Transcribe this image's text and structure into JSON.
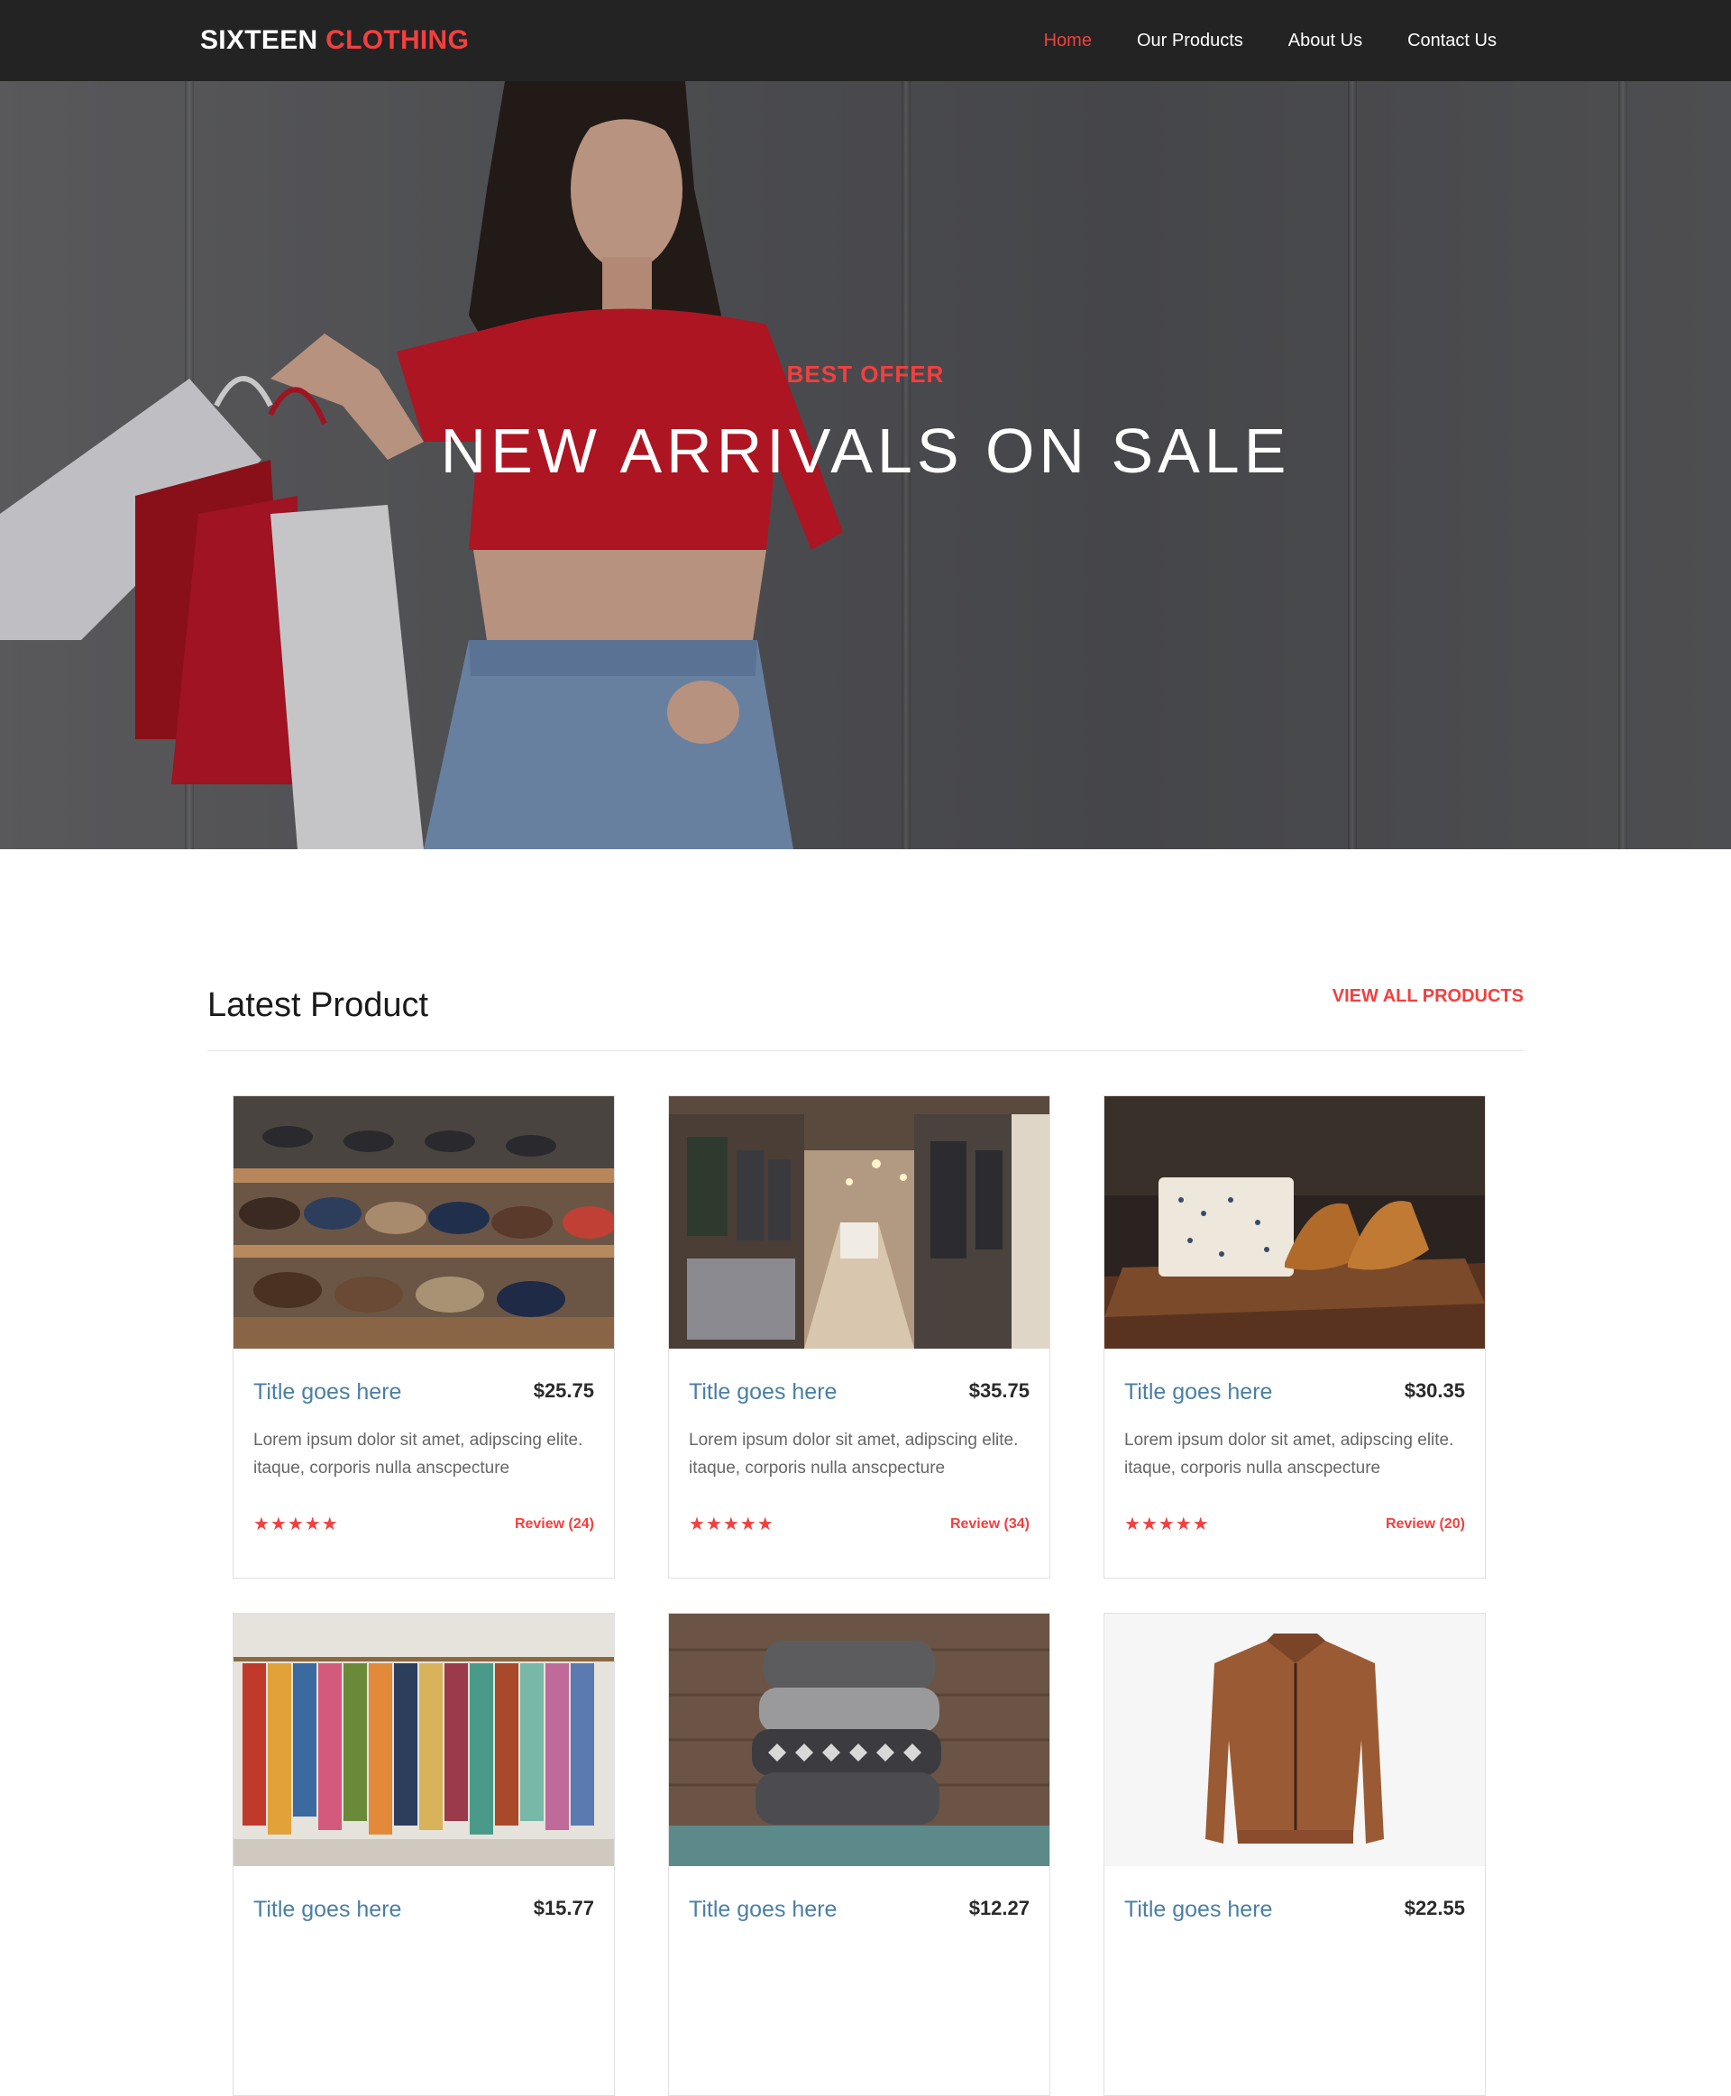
{
  "brand": {
    "name_main": "SIXTEEN",
    "name_accent": "CLOTHING",
    "accent_color": "#f33f3f"
  },
  "nav": [
    {
      "label": "Home",
      "active": true
    },
    {
      "label": "Our Products",
      "active": false
    },
    {
      "label": "About Us",
      "active": false
    },
    {
      "label": "Contact Us",
      "active": false
    }
  ],
  "hero": {
    "subtitle": "BEST OFFER",
    "title": "NEW ARRIVALS ON SALE"
  },
  "latest": {
    "title": "Latest Product",
    "view_all": "VIEW ALL PRODUCTS",
    "products": [
      {
        "title": "Title goes here",
        "price": "$25.75",
        "desc": "Lorem ipsum dolor sit amet, adipscing elite. itaque, corporis nulla anscpecture",
        "stars": "★★★★★",
        "review": "Review (24)",
        "image": "shoe-shelf-image"
      },
      {
        "title": "Title goes here",
        "price": "$35.75",
        "desc": "Lorem ipsum dolor sit amet, adipscing elite. itaque, corporis nulla anscpecture",
        "stars": "★★★★★",
        "review": "Review (34)",
        "image": "clothing-store-image"
      },
      {
        "title": "Title goes here",
        "price": "$30.35",
        "desc": "Lorem ipsum dolor sit amet, adipscing elite. itaque, corporis nulla anscpecture",
        "stars": "★★★★★",
        "review": "Review (20)",
        "image": "shirts-shoes-image"
      },
      {
        "title": "Title goes here",
        "price": "$15.77",
        "desc": "",
        "stars": "",
        "review": "",
        "image": "clothes-rack-image"
      },
      {
        "title": "Title goes here",
        "price": "$12.27",
        "desc": "",
        "stars": "",
        "review": "",
        "image": "sweaters-stack-image"
      },
      {
        "title": "Title goes here",
        "price": "$22.55",
        "desc": "",
        "stars": "",
        "review": "",
        "image": "leather-jacket-image"
      }
    ]
  }
}
